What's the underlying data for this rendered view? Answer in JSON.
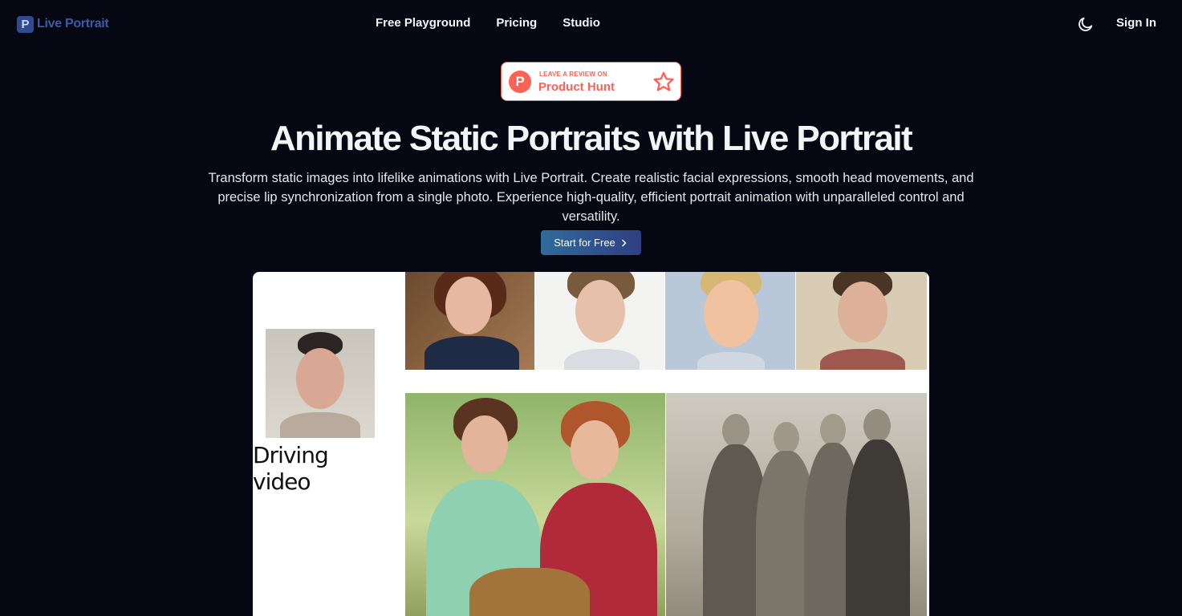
{
  "header": {
    "logo_text": "Live Portrait",
    "logo_mark": "P",
    "nav": [
      {
        "label": "Free Playground"
      },
      {
        "label": "Pricing"
      },
      {
        "label": "Studio"
      }
    ],
    "theme_icon": "moon-icon",
    "signin_label": "Sign In"
  },
  "badge": {
    "top_text": "LEAVE A REVIEW ON",
    "name": "Product Hunt",
    "logo_letter": "P",
    "icon": "star-icon",
    "color": "#ff6154"
  },
  "hero": {
    "title": "Animate Static Portraits with Live Portrait",
    "description": "Transform static images into lifelike animations with Live Portrait. Create realistic facial expressions, smooth head movements, and precise lip synchronization from a single photo. Experience high-quality, efficient portrait animation with unparalleled control and versatility.",
    "cta_label": "Start for Free",
    "cta_icon": "chevron-right-icon"
  },
  "demo": {
    "driving_label": "Driving video"
  },
  "colors": {
    "background": "#050812",
    "accent_start": "#2f6b9b",
    "accent_end": "#2f3e82"
  }
}
